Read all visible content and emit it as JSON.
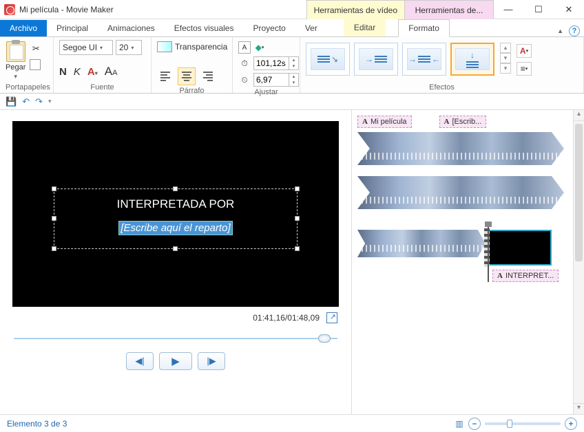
{
  "window": {
    "title": "Mi película - Movie Maker",
    "context_tabs": {
      "video": "Herramientas de vídeo",
      "text": "Herramientas de..."
    }
  },
  "tabs": {
    "archivo": "Archivo",
    "principal": "Principal",
    "animaciones": "Animaciones",
    "efectos": "Efectos visuales",
    "proyecto": "Proyecto",
    "ver": "Ver",
    "editar": "Editar",
    "formato": "Formato"
  },
  "ribbon": {
    "clipboard": {
      "paste": "Pegar",
      "label": "Portapapeles"
    },
    "font": {
      "name": "Segoe UI",
      "size": "20",
      "transparency": "Transparencia",
      "label": "Fuente"
    },
    "paragraph": {
      "label": "Párrafo"
    },
    "adjust": {
      "start_time": "101,12s",
      "duration": "6,97",
      "label": "Ajustar"
    },
    "effects": {
      "label": "Efectos"
    }
  },
  "preview": {
    "title_text": "INTERPRETADA POR",
    "placeholder_text": "[Escribe aquí el reparto]",
    "time_current": "01:41,16",
    "time_total": "01:48,09"
  },
  "timeline": {
    "label_movie": "Mi película",
    "label_write": "[Escrib...",
    "label_interpret": "INTERPRET..."
  },
  "status": {
    "text": "Elemento 3 de 3"
  }
}
